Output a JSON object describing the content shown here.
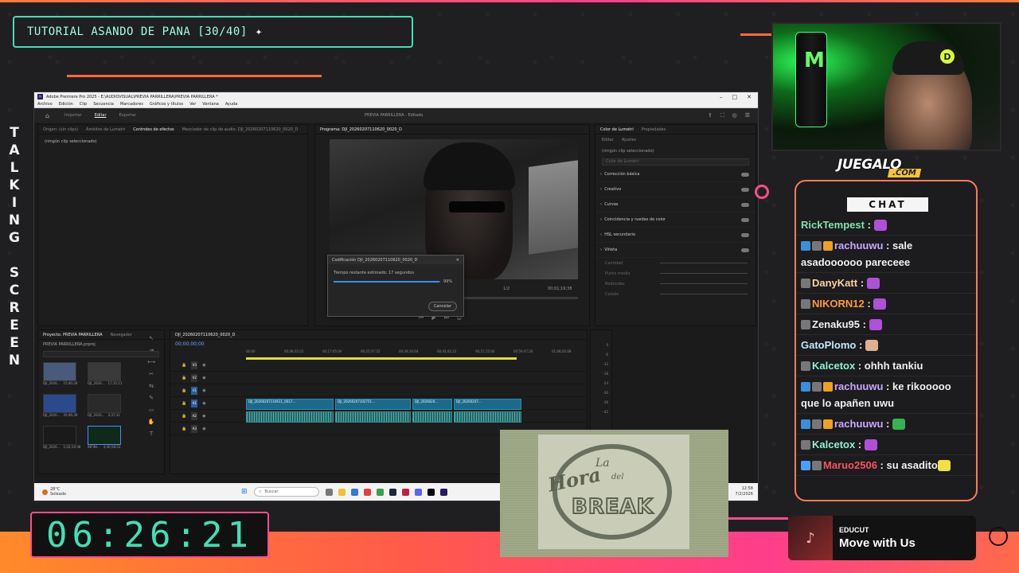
{
  "overlay": {
    "title": "TUTORIAL ASANDO DE PANA [30/40]",
    "side_text": "TALKING SCREEN",
    "timer": "06:26:21",
    "logo_main": "JUEGALO",
    "logo_sub": ".COM",
    "chat_header": "CHAT",
    "accent_teal": "#3fe1b5",
    "accent_pink": "#ff4d8d",
    "accent_orange": "#ff6a3d"
  },
  "premiere": {
    "window_title": "Adobe Premiere Pro 2025 - E:\\AUDIOVISUAL\\PREVIA PARRILLERA\\PREVIA PARRILLERA *",
    "menu": [
      "Archivo",
      "Edición",
      "Clip",
      "Secuencia",
      "Marcadores",
      "Gráficos y títulos",
      "Ver",
      "Ventana",
      "Ayuda"
    ],
    "workspaces": [
      "Importar",
      "Editar",
      "Exportar"
    ],
    "active_workspace": "Editar",
    "project_title": "PREVIA PARRILLERA - Editado",
    "source_tabs": [
      "Origen: (sin clips)",
      "Ámbitos de Lumetri",
      "Controles de efectos",
      "Mezclador de clip de audio: DJI_20260207110620_0020_D"
    ],
    "active_source_tab": "Controles de efectos",
    "no_clip": "(ningún clip seleccionado)",
    "program_tab": "Programa: DJI_20260207110620_0020_D",
    "program_timecode": "00;01;19;38",
    "fit_label": "1/2",
    "dialog": {
      "title": "Codificación DJI_20260207110620_0020_D",
      "status": "Tiempo restante estimado: 17 segundos",
      "progress_percent": 99,
      "progress_label": "99%",
      "cancel_label": "Cancelar"
    },
    "lumetri": {
      "tabs": [
        "Color de Lumetri",
        "Propiedades"
      ],
      "sub_tabs": [
        "Editar",
        "Ajustes"
      ],
      "no_clip": "(ningún clip seleccionado)",
      "dropdown": "Color de Lumetri",
      "sections": [
        "Corrección básica",
        "Creativo",
        "Curvas",
        "Coincidencia y ruedas de color",
        "HSL secundario",
        "Viñeta"
      ],
      "sliders": [
        "Cantidad",
        "Punto medio",
        "Redondez",
        "Calado"
      ]
    },
    "project_panel": {
      "tabs": [
        "Proyecto: PREVIA PARRILLERA",
        "Navegador"
      ],
      "file": "PREVIA PARRILLERA.prproj",
      "thumbs": [
        {
          "name": "DJI_2026...",
          "dur": "15;40;34"
        },
        {
          "name": "DJI_2026...",
          "dur": "17;15;11"
        },
        {
          "name": "DJI_2026...",
          "dur": "20;46;39"
        },
        {
          "name": "DJI_2026...",
          "dur": "3;37;31"
        },
        {
          "name": "DJI_2026...",
          "dur": "1;03;19;38"
        },
        {
          "name": "INFINI...",
          "dur": "3;46;58;52"
        }
      ]
    },
    "timeline": {
      "tab": "DJI_20260207110620_0020_D",
      "timecode": "00;00;00;00",
      "ruler": [
        "00;00",
        "00;08;32;22",
        "00;17;05;04",
        "00;25;37;22",
        "00;34;10;04",
        "00;42;42;22",
        "00;51;15;04",
        "00;59;47;26",
        "01;08;20;08"
      ],
      "video_tracks": [
        "V3",
        "V2",
        "V1"
      ],
      "audio_tracks": [
        "A1",
        "A2",
        "A3"
      ],
      "clips": [
        "DJI_20260207110611_0017...",
        "DJI_20260207102751...",
        "DJI_2026020...",
        "DJI_20260207..."
      ],
      "meter": [
        "0",
        "-6",
        "-12",
        "-18",
        "-24",
        "-30",
        "-36",
        "-42"
      ]
    },
    "taskbar": {
      "weather_temp": "28°C",
      "weather_desc": "Soleado",
      "search": "Buscar",
      "time": "12:58",
      "date": "7/2/2026"
    }
  },
  "chat": [
    {
      "user": "RickTempest",
      "color": "#7fe3b0",
      "text": "",
      "badges": [],
      "emote": "#b04fd8"
    },
    {
      "user": "rachuuwu",
      "color": "#c9a8ff",
      "text": "sale asadoooooo pareceee",
      "badges": [
        "#3a8fd8",
        "#777",
        "#f0a020"
      ],
      "emote": ""
    },
    {
      "user": "DanyKatt",
      "color": "#ffd0a0",
      "text": "",
      "badges": [
        "#777"
      ],
      "emote": "#b04fd8"
    },
    {
      "user": "NIKORN12",
      "color": "#ff9a3a",
      "text": "",
      "badges": [
        "#777"
      ],
      "emote": "#b04fd8"
    },
    {
      "user": "Zenaku95",
      "color": "#f0f0f0",
      "text": "",
      "badges": [
        "#777"
      ],
      "emote": "#b04fd8"
    },
    {
      "user": "GatoPlomo",
      "color": "#bfe8ff",
      "text": "",
      "badges": [],
      "emote": "#e0b090"
    },
    {
      "user": "Kalcetox",
      "color": "#8ff0d0",
      "text": "ohhh tankiu",
      "badges": [
        "#777"
      ],
      "emote": ""
    },
    {
      "user": "rachuuwu",
      "color": "#c9a8ff",
      "text": "ke rikooooo que lo apañen uwu",
      "badges": [
        "#3a8fd8",
        "#777",
        "#f0a020"
      ],
      "emote": ""
    },
    {
      "user": "rachuuwu",
      "color": "#c9a8ff",
      "text": "",
      "badges": [
        "#3a8fd8",
        "#777",
        "#f0a020"
      ],
      "emote": "#3ab050"
    },
    {
      "user": "Kalcetox",
      "color": "#8ff0d0",
      "text": "",
      "badges": [
        "#777"
      ],
      "emote": "#b04fd8"
    },
    {
      "user": "Maruo2506",
      "color": "#ff5060",
      "text": "su asadito",
      "badges": [
        "#4aa0ff",
        "#777"
      ],
      "emote": "#f0e040"
    }
  ],
  "now_playing": {
    "artist": "EDUCUT",
    "title": "Move with Us"
  },
  "break_screen": {
    "la": "La",
    "hora": "Hora",
    "del": "del",
    "break": "BREAK"
  }
}
